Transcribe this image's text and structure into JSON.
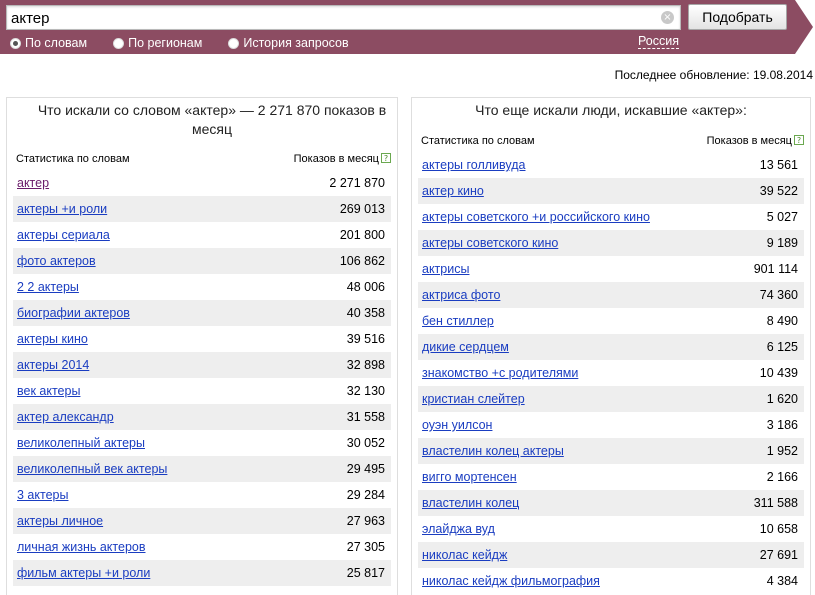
{
  "search": {
    "query": "актер",
    "submit_label": "Подобрать"
  },
  "modes": [
    {
      "label": "По словам",
      "checked": true
    },
    {
      "label": "По регионам",
      "checked": false
    },
    {
      "label": "История запросов",
      "checked": false
    }
  ],
  "region": "Россия",
  "last_update": "Последнее обновление: 19.08.2014",
  "colors": {
    "band": "#8c4c62",
    "link": "#1a3dc1",
    "visited": "#6a1b6a",
    "stripe": "#eeeeee"
  },
  "left_panel": {
    "title": "Что искали со словом «актер» — 2 271 870 показов в месяц",
    "col_left": "Статистика по словам",
    "col_right": "Показов в месяц",
    "rows": [
      {
        "kw": "актер",
        "count": "2 271 870"
      },
      {
        "kw": "актеры +и роли",
        "count": "269 013"
      },
      {
        "kw": "актеры сериала",
        "count": "201 800"
      },
      {
        "kw": "фото актеров",
        "count": "106 862"
      },
      {
        "kw": "2 2 актеры",
        "count": "48 006"
      },
      {
        "kw": "биографии актеров",
        "count": "40 358"
      },
      {
        "kw": "актеры кино",
        "count": "39 516"
      },
      {
        "kw": "актеры 2014",
        "count": "32 898"
      },
      {
        "kw": "век актеры",
        "count": "32 130"
      },
      {
        "kw": "актер александр",
        "count": "31 558"
      },
      {
        "kw": "великолепный актеры",
        "count": "30 052"
      },
      {
        "kw": "великолепный век актеры",
        "count": "29 495"
      },
      {
        "kw": "3 актеры",
        "count": "29 284"
      },
      {
        "kw": "актеры личное",
        "count": "27 963"
      },
      {
        "kw": "личная жизнь актеров",
        "count": "27 305"
      },
      {
        "kw": "фильм актеры +и роли",
        "count": "25 817"
      }
    ]
  },
  "right_panel": {
    "title": "Что еще искали люди, искавшие «актер»:",
    "col_left": "Статистика по словам",
    "col_right": "Показов в месяц",
    "rows": [
      {
        "kw": "актеры голливуда",
        "count": "13 561"
      },
      {
        "kw": "актер кино",
        "count": "39 522"
      },
      {
        "kw": "актеры советского +и российского кино",
        "count": "5 027"
      },
      {
        "kw": "актеры советского кино",
        "count": "9 189"
      },
      {
        "kw": "актрисы",
        "count": "901 114"
      },
      {
        "kw": "актриса фото",
        "count": "74 360"
      },
      {
        "kw": "бен стиллер",
        "count": "8 490"
      },
      {
        "kw": "дикие сердцем",
        "count": "6 125"
      },
      {
        "kw": "знакомство +с родителями",
        "count": "10 439"
      },
      {
        "kw": "кристиан слейтер",
        "count": "1 620"
      },
      {
        "kw": "оуэн уилсон",
        "count": "3 186"
      },
      {
        "kw": "властелин колец актеры",
        "count": "1 952"
      },
      {
        "kw": "вигго мортенсен",
        "count": "2 166"
      },
      {
        "kw": "властелин колец",
        "count": "311 588"
      },
      {
        "kw": "элайджа вуд",
        "count": "10 658"
      },
      {
        "kw": "николас кейдж",
        "count": "27 691"
      },
      {
        "kw": "николас кейдж фильмография",
        "count": "4 384"
      }
    ]
  }
}
